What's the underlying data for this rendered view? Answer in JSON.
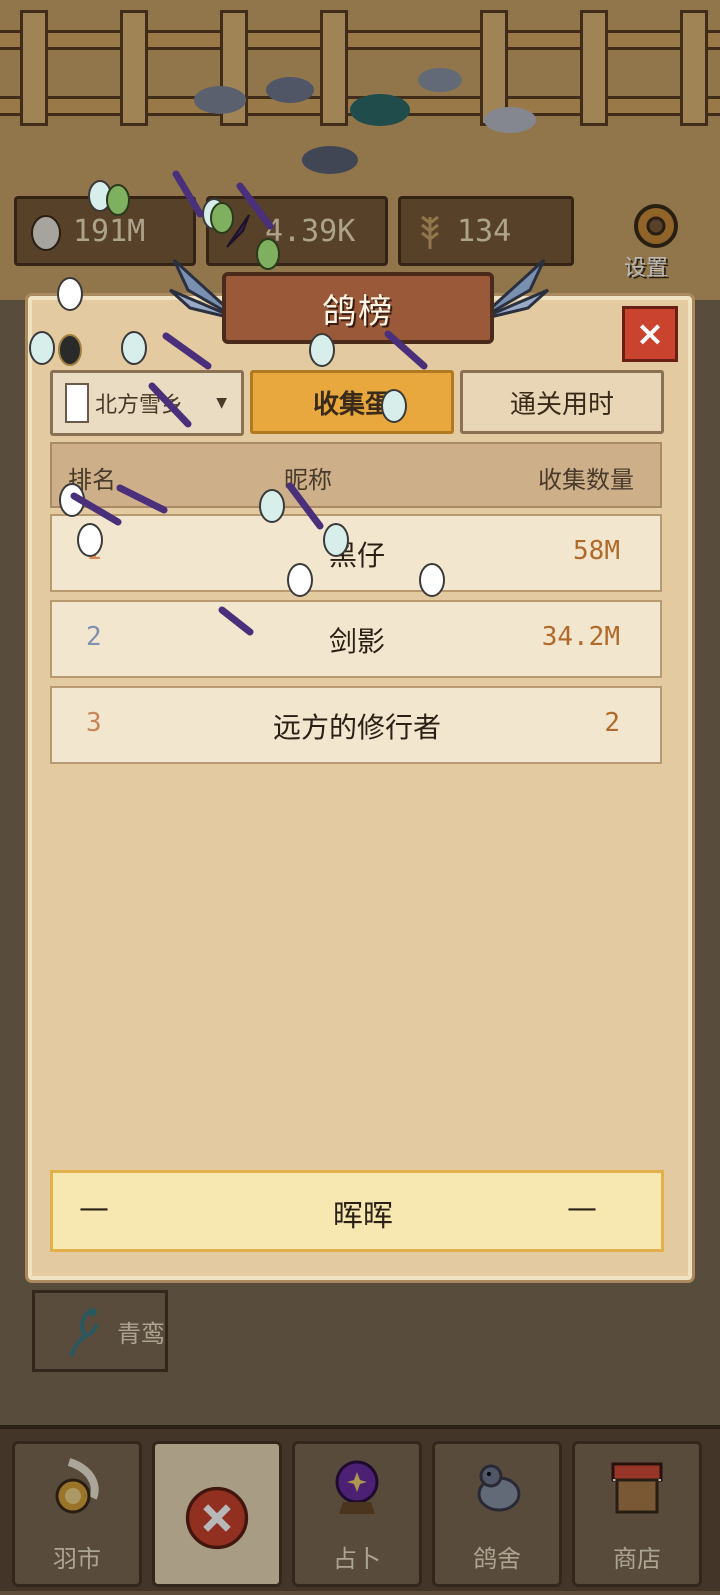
{
  "stats": {
    "eggs": "191M",
    "feathers": "4.39K",
    "grain": "134",
    "settings_label": "设置"
  },
  "panel": {
    "title": "鸽榜",
    "close_symbol": "×",
    "region_dropdown": "北方雪乡",
    "tabs": [
      "收集蛋",
      "通关用时"
    ],
    "active_tab": "收集蛋",
    "columns": [
      "排名",
      "昵称",
      "收集数量"
    ],
    "rows": [
      {
        "rank": "1",
        "name": "黑仔",
        "count": "58M"
      },
      {
        "rank": "2",
        "name": "剑影",
        "count": "34.2M"
      },
      {
        "rank": "3",
        "name": "远方的修行者",
        "count": "2"
      }
    ],
    "self_row": {
      "rank": "—",
      "name": "晖晖",
      "count": "—"
    }
  },
  "side_button": {
    "label": "青鸾"
  },
  "nav": [
    {
      "label": "羽市",
      "icon": "coin-feather-icon"
    },
    {
      "label": "",
      "icon": "close-icon"
    },
    {
      "label": "占卜",
      "icon": "crystal-ball-icon"
    },
    {
      "label": "鸽舍",
      "icon": "pigeon-icon"
    },
    {
      "label": "商店",
      "icon": "shop-stall-icon"
    }
  ],
  "colors": {
    "panel_bg": "#e4caa0",
    "active_tab": "#e8a83e",
    "close_red": "#c9432e",
    "count_text": "#b06a2a"
  }
}
